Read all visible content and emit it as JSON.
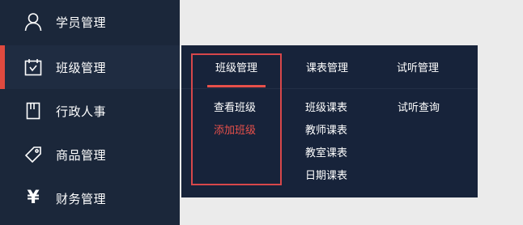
{
  "sidebar": {
    "items": [
      {
        "label": "学员管理",
        "icon": "user-icon"
      },
      {
        "label": "班级管理",
        "icon": "calendar-icon",
        "active": true
      },
      {
        "label": "行政人事",
        "icon": "book-icon"
      },
      {
        "label": "商品管理",
        "icon": "tag-icon"
      },
      {
        "label": "财务管理",
        "icon": "yen-icon",
        "glyph": "¥"
      }
    ]
  },
  "submenu": {
    "tabs": [
      {
        "label": "班级管理",
        "active": true
      },
      {
        "label": "课表管理"
      },
      {
        "label": "试听管理"
      }
    ],
    "columns": [
      [
        "查看班级",
        "添加班级"
      ],
      [
        "班级课表",
        "教师课表",
        "教室课表",
        "日期课表"
      ],
      [
        "试听查询"
      ]
    ]
  },
  "colors": {
    "sidebar_bg": "#1b273a",
    "panel_bg": "#17233a",
    "accent": "#e04a3f",
    "active_link": "#e8504a"
  }
}
